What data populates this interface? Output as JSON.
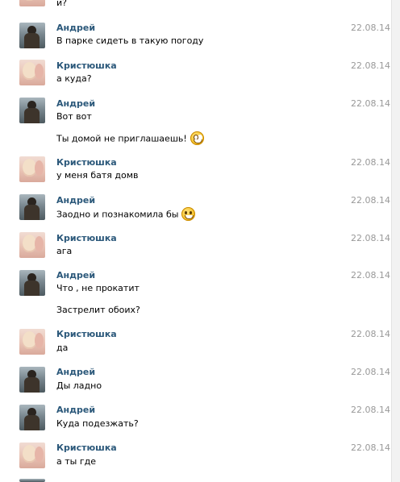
{
  "top_fragment": "и?",
  "messages": [
    {
      "author": "Андрей",
      "date": "22.08.14",
      "lines": [
        "В парке сидеть в такую погоду"
      ]
    },
    {
      "author": "Кристюшка",
      "date": "22.08.14",
      "lines": [
        "а куда?"
      ]
    },
    {
      "author": "Андрей",
      "date": "22.08.14",
      "lines": [
        "Вот вот",
        "Ты домой не приглашаешь!"
      ]
    },
    {
      "author": "Кристюшка",
      "date": "22.08.14",
      "lines": [
        "у меня батя домв"
      ]
    },
    {
      "author": "Андрей",
      "date": "22.08.14",
      "lines": [
        "Заодно и познакомила бы"
      ]
    },
    {
      "author": "Кристюшка",
      "date": "22.08.14",
      "lines": [
        "ага"
      ]
    },
    {
      "author": "Андрей",
      "date": "22.08.14",
      "lines": [
        "Что , не прокатит",
        "Застрелит обоих?"
      ]
    },
    {
      "author": "Кристюшка",
      "date": "22.08.14",
      "lines": [
        "да"
      ]
    },
    {
      "author": "Андрей",
      "date": "22.08.14",
      "lines": [
        "Ды ладно"
      ]
    },
    {
      "author": "Андрей",
      "date": "22.08.14",
      "lines": [
        "Куда подезжать?"
      ]
    },
    {
      "author": "Кристюшка",
      "date": "22.08.14",
      "lines": [
        "а ты где"
      ]
    }
  ]
}
